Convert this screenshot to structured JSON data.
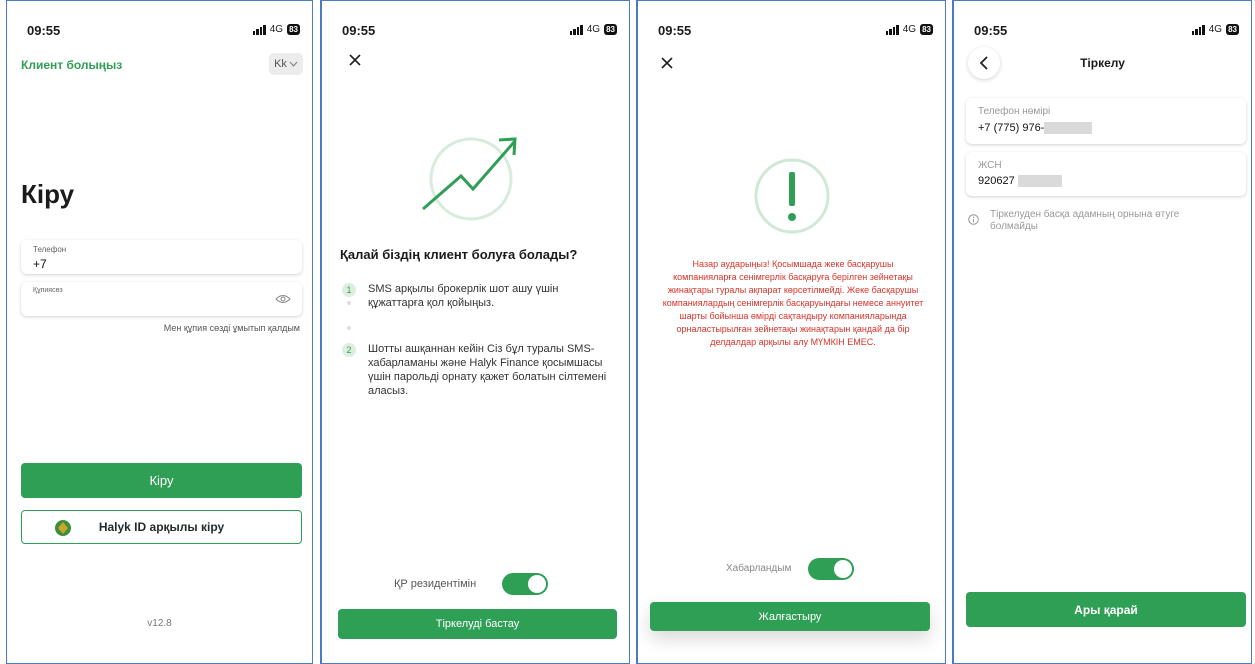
{
  "status": {
    "time": "09:55",
    "network": "4G",
    "battery": "83"
  },
  "screen1": {
    "client_link": "Клиент болыңыз",
    "lang": "Kk",
    "title": "Кіру",
    "phone_label": "Телефон",
    "phone_value": "+7",
    "password_label": "Құпиясөз",
    "forgot": "Мен құпия сөзді ұмытып қалдым",
    "login_button": "Кіру",
    "halyk_button": "Halyk ID арқылы кіру",
    "version": "v12.8"
  },
  "screen2": {
    "heading": "Қалай біздің клиент болуға болады?",
    "steps": [
      {
        "num": "1",
        "text": "SMS арқылы брокерлік шот ашу үшін құжаттарға қол қойыңыз."
      },
      {
        "num": "2",
        "text": "Шотты ашқаннан кейін Сіз бұл туралы SMS-хабарламаны және Halyk Finance қосымшасы үшін парольді орнату қажет болатын сілтемені аласыз."
      }
    ],
    "resident_label": "ҚР резидентімін",
    "start_button": "Тіркелуді бастау"
  },
  "screen3": {
    "warning": "Назар аударыңыз! Қосымшада жеке басқарушы компанияларға сенімгерлік басқаруға берілген зейнетақы жинақтары туралы ақпарат көрсетілмейді. Жеке басқарушы компаниялардың сенімгерлік басқаруындағы немесе аннуитет шарты бойынша өмірді сақтандыру компанияларында орналастырылған зейнетақы жинақтарын қандай да бір делдалдар арқылы алу МҮМКІН ЕМЕС.",
    "informed_label": "Хабарландым",
    "continue_button": "Жалғастыру"
  },
  "screen4": {
    "title": "Тіркелу",
    "phone_label": "Телефон нөмірі",
    "phone_value": "+7 (775) 976-",
    "iin_label": "ЖСН",
    "iin_value": "920627",
    "note": "Тіркелуден басқа адамның орнына өтуге болмайды",
    "next_button": "Ары қарай"
  },
  "colors": {
    "accent": "#2f9f55",
    "warning_red": "#d9342b",
    "frame_border": "#4a7bc4"
  }
}
